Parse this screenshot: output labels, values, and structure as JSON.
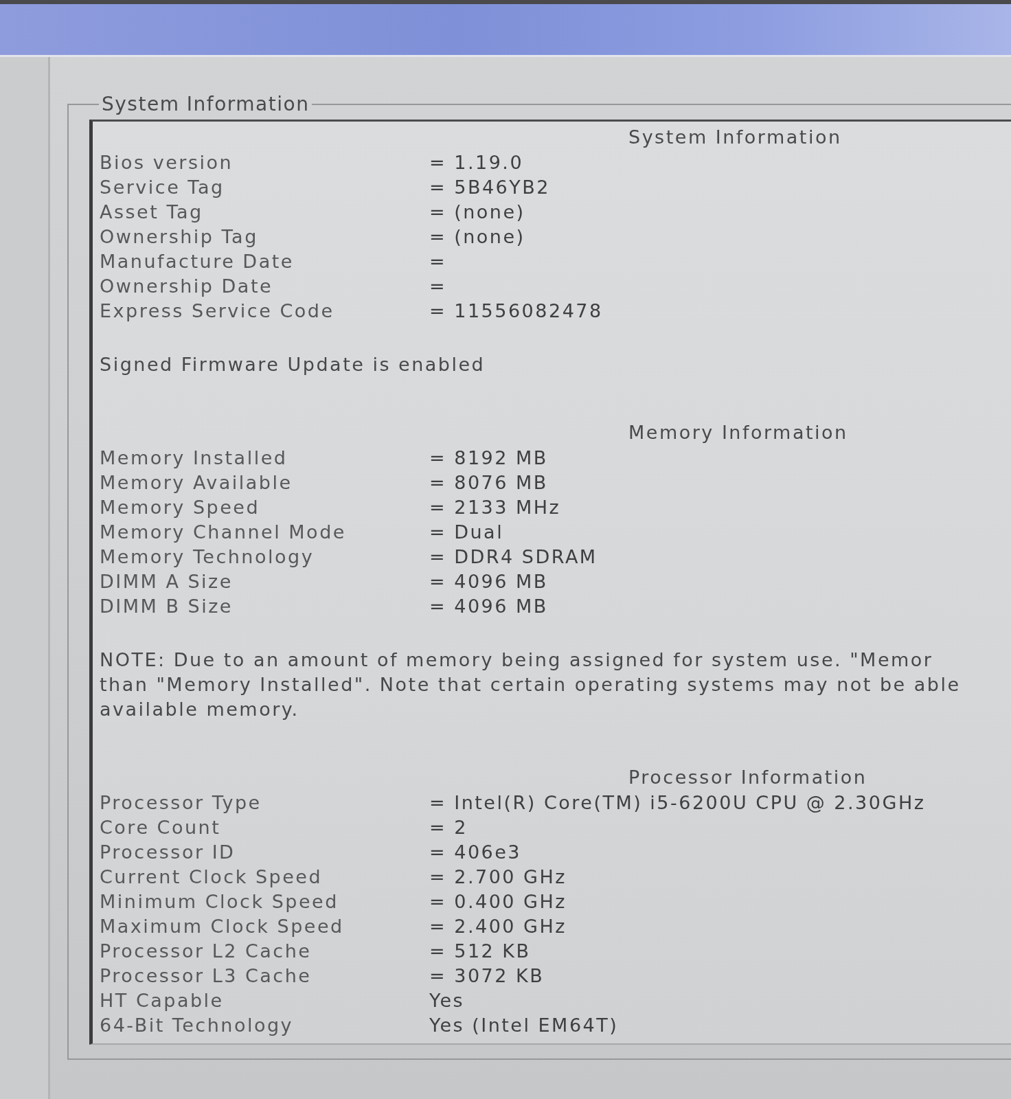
{
  "group": {
    "title": "System Information",
    "sections": [
      {
        "kind": "table",
        "heading": "System Information",
        "rows": [
          {
            "label": "Bios version",
            "value": "= 1.19.0"
          },
          {
            "label": "Service Tag",
            "value": "= 5B46YB2"
          },
          {
            "label": "Asset Tag",
            "value": "= (none)"
          },
          {
            "label": "Ownership Tag",
            "value": "= (none)"
          },
          {
            "label": "Manufacture Date",
            "value": "="
          },
          {
            "label": "Ownership Date",
            "value": "="
          },
          {
            "label": "Express Service Code",
            "value": "= 11556082478"
          }
        ]
      },
      {
        "kind": "text",
        "lines": [
          "Signed Firmware Update is enabled"
        ]
      },
      {
        "kind": "table",
        "heading": "Memory Information",
        "rows": [
          {
            "label": "Memory Installed",
            "value": "= 8192 MB"
          },
          {
            "label": "Memory Available",
            "value": "= 8076 MB"
          },
          {
            "label": "Memory Speed",
            "value": "= 2133 MHz"
          },
          {
            "label": "Memory Channel Mode",
            "value": "= Dual"
          },
          {
            "label": "Memory Technology",
            "value": "= DDR4 SDRAM"
          },
          {
            "label": "DIMM A Size",
            "value": "= 4096 MB"
          },
          {
            "label": "DIMM B Size",
            "value": "= 4096 MB"
          }
        ]
      },
      {
        "kind": "text",
        "lines": [
          "NOTE: Due to an amount of memory being assigned for system use. \"Memor",
          "than \"Memory Installed\". Note that certain operating systems may not be able",
          "available memory."
        ]
      },
      {
        "kind": "table",
        "heading": "Processor Information",
        "rows": [
          {
            "label": "Processor Type",
            "value": "= Intel(R) Core(TM) i5-6200U CPU @ 2.30GHz"
          },
          {
            "label": "Core Count",
            "value": "= 2"
          },
          {
            "label": "Processor ID",
            "value": "= 406e3"
          },
          {
            "label": "Current Clock Speed",
            "value": "= 2.700 GHz"
          },
          {
            "label": "Minimum Clock Speed",
            "value": "= 0.400 GHz"
          },
          {
            "label": "Maximum Clock Speed",
            "value": "= 2.400 GHz"
          },
          {
            "label": "Processor L2 Cache",
            "value": "= 512 KB"
          },
          {
            "label": "Processor L3 Cache",
            "value": "= 3072 KB"
          },
          {
            "label": "HT Capable",
            "value": "Yes"
          },
          {
            "label": "64-Bit Technology",
            "value": "Yes (Intel EM64T)"
          }
        ]
      }
    ]
  }
}
